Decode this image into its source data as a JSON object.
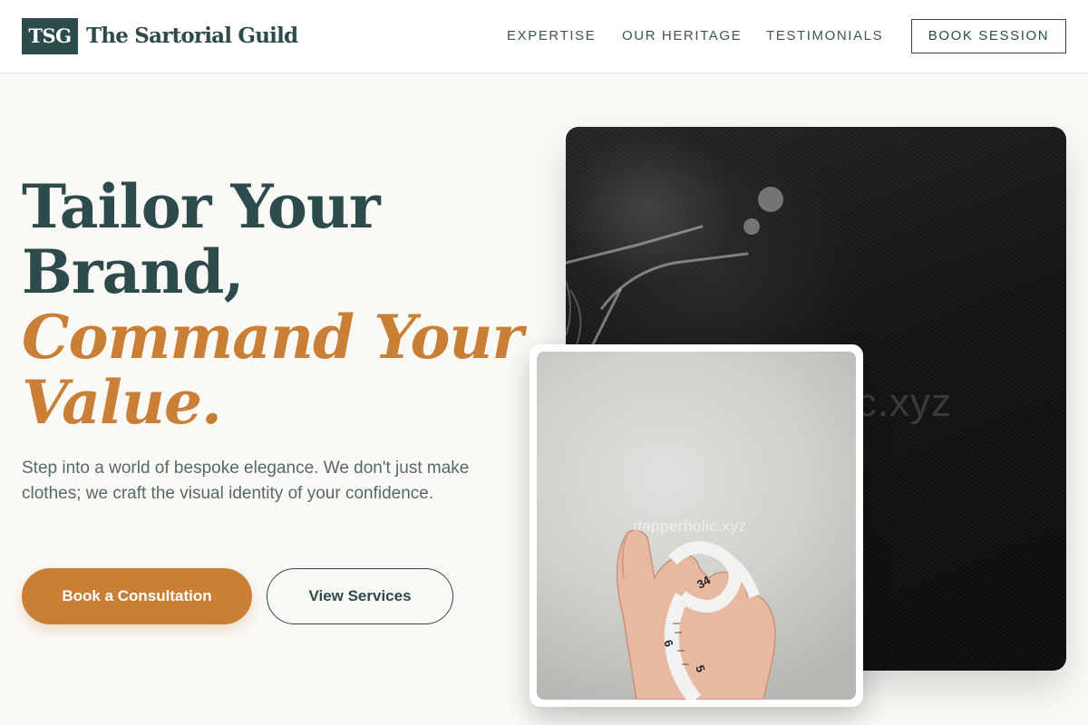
{
  "header": {
    "logo_mark": "TSG",
    "brand_name": "The Sartorial Guild",
    "nav": [
      {
        "label": "EXPERTISE"
      },
      {
        "label": "OUR HERITAGE"
      },
      {
        "label": "TESTIMONIALS"
      }
    ],
    "cta_label": "BOOK SESSION"
  },
  "hero": {
    "headline_line1": "Tailor Your",
    "headline_line2": "Brand,",
    "headline_accent_line1": "Command Your",
    "headline_accent_line2": "Value.",
    "lede": "Step into a world of bespoke elegance. We don't just make clothes; we craft the visual identity of your confidence.",
    "primary_button": "Book a Consultation",
    "secondary_button": "View Services"
  },
  "images": {
    "back_image_icon": "sewing-machine-photo",
    "back_watermark": "ic.xyz",
    "front_image_icon": "tape-measure-hand-photo",
    "front_watermark": "dapperholic.xyz"
  },
  "colors": {
    "brand_dark": "#2d4a4d",
    "accent": "#c97f36",
    "page_background": "#faf9f6"
  }
}
